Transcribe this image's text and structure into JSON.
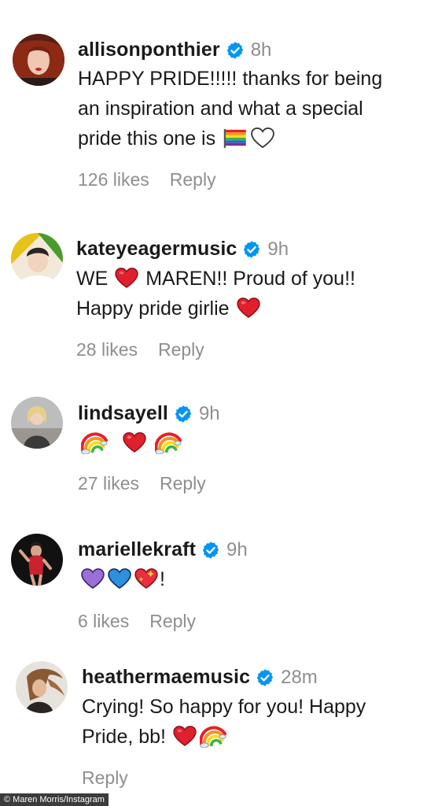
{
  "comments": [
    {
      "username": "allisonponthier",
      "time": "8h",
      "lines": [
        "HAPPY PRIDE!!!!! thanks for being",
        "an inspiration and what a special",
        "pride this one is"
      ],
      "likes": "126 likes",
      "reply": "Reply",
      "avatar_icon": "red-hair-portrait-avatar",
      "emojis": [
        "rainbow-flag-icon",
        "white-heart-icon"
      ]
    },
    {
      "username": "kateyeagermusic",
      "time": "9h",
      "line1_a": "WE",
      "line1_b": "MAREN!! Proud of you!!",
      "line2": "Happy pride girlie",
      "likes": "28 likes",
      "reply": "Reply",
      "avatar_icon": "yellow-green-background-portrait-avatar",
      "emojis": [
        "red-heart-icon",
        "red-heart-icon"
      ]
    },
    {
      "username": "lindsayell",
      "time": "9h",
      "likes": "27 likes",
      "reply": "Reply",
      "avatar_icon": "blonde-portrait-avatar",
      "emojis": [
        "rainbow-icon",
        "red-heart-icon",
        "rainbow-icon"
      ]
    },
    {
      "username": "mariellekraft",
      "time": "9h",
      "tail": "!",
      "likes": "6 likes",
      "reply": "Reply",
      "avatar_icon": "dark-background-portrait-avatar",
      "emojis": [
        "purple-heart-icon",
        "blue-heart-icon",
        "sparkling-heart-icon"
      ]
    },
    {
      "username": "heathermaemusic",
      "time": "28m",
      "line1": "Crying! So happy for you! Happy",
      "line2": "Pride, bb!",
      "reply": "Reply",
      "avatar_icon": "windswept-hair-portrait-avatar",
      "emojis": [
        "red-heart-icon",
        "rainbow-icon"
      ]
    }
  ],
  "credit": "© Maren Morris/Instagram",
  "colors": {
    "verified": "#0095f6",
    "meta_text": "#8e8e8e",
    "body_text": "#1a1a1a"
  }
}
